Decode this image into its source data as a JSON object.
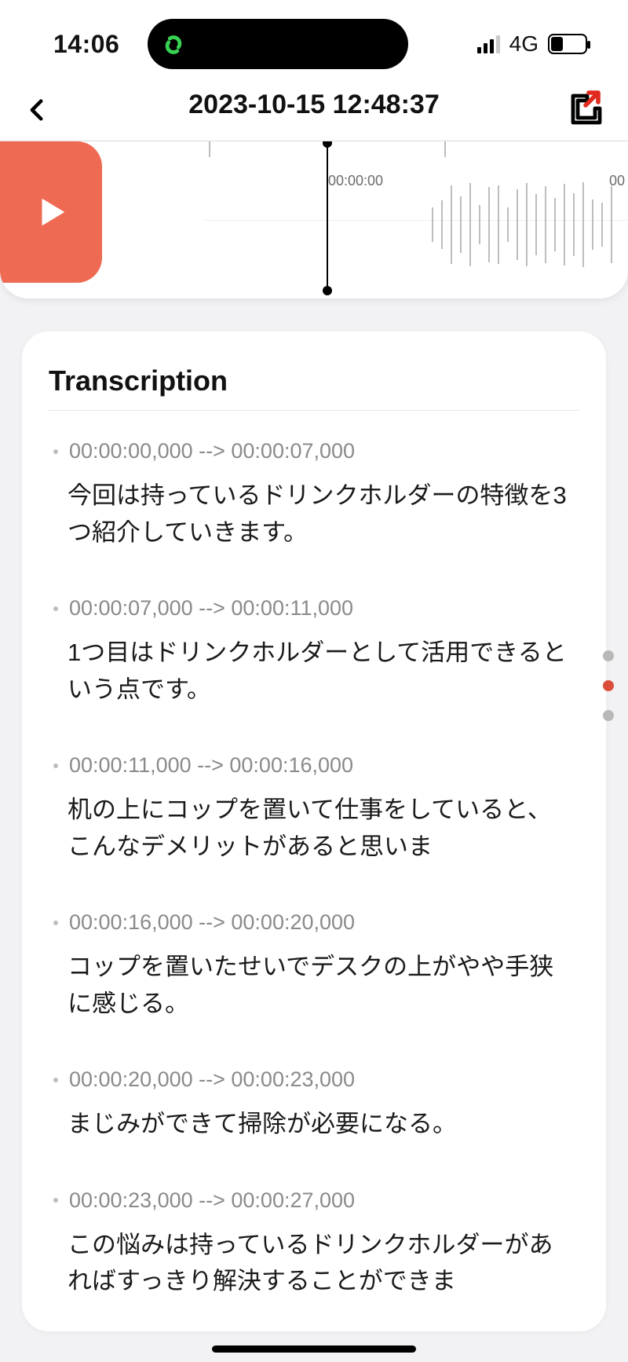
{
  "status": {
    "time": "14:06",
    "network": "4G"
  },
  "header": {
    "title": "2023-10-15 12:48:37"
  },
  "player": {
    "current_time": "00:00:00",
    "next_tick": "00"
  },
  "transcription": {
    "title": "Transcription",
    "segments": [
      {
        "range": "00:00:00,000 --> 00:00:07,000",
        "text": "今回は持っているドリンクホルダーの特徴を3つ紹介していきます。"
      },
      {
        "range": "00:00:07,000 --> 00:00:11,000",
        "text": "1つ目はドリンクホルダーとして活用できるという点です。"
      },
      {
        "range": "00:00:11,000 --> 00:00:16,000",
        "text": "机の上にコップを置いて仕事をしていると、こんなデメリットがあると思いま"
      },
      {
        "range": "00:00:16,000 --> 00:00:20,000",
        "text": "コップを置いたせいでデスクの上がやや手狭に感じる。"
      },
      {
        "range": "00:00:20,000 --> 00:00:23,000",
        "text": "まじみができて掃除が必要になる。"
      },
      {
        "range": "00:00:23,000 --> 00:00:27,000",
        "text": "この悩みは持っているドリンクホルダーがあればすっきり解決することができま"
      }
    ]
  }
}
